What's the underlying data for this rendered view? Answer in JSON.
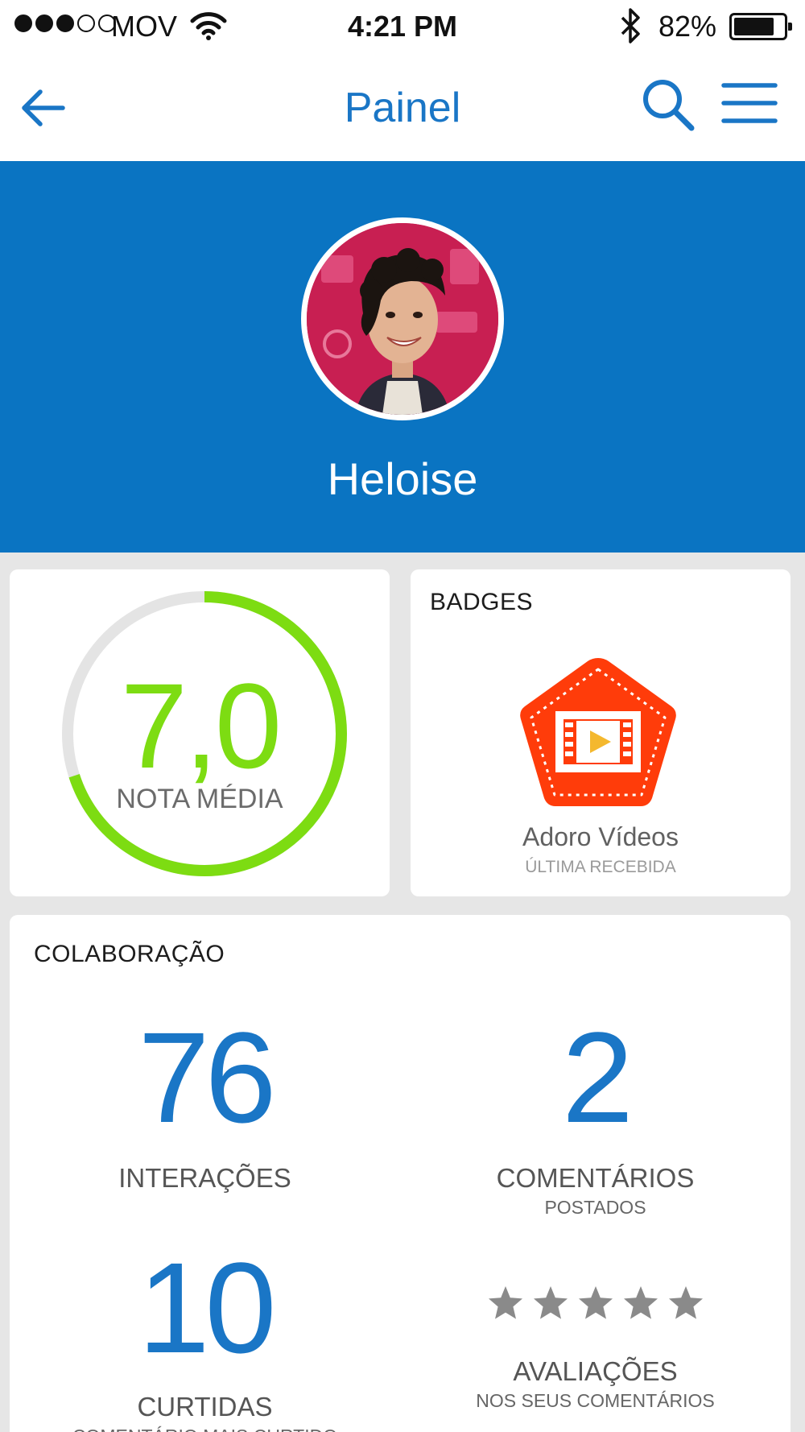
{
  "status": {
    "signal": [
      true,
      true,
      true,
      false,
      false
    ],
    "carrier": "MOV",
    "time": "4:21 PM",
    "battery_pct": "82%",
    "battery_level": 0.82
  },
  "nav": {
    "title": "Painel"
  },
  "profile": {
    "name": "Heloise"
  },
  "score": {
    "value": "7,0",
    "label": "NOTA MÉDIA",
    "fraction": 0.7
  },
  "badges": {
    "title": "BADGES",
    "latest_name": "Adoro Vídeos",
    "latest_caption": "ÚLTIMA RECEBIDA"
  },
  "collab": {
    "title": "COLABORAÇÃO",
    "interactions": {
      "value": "76",
      "label": "INTERAÇÕES"
    },
    "comments": {
      "value": "2",
      "label": "COMENTÁRIOS",
      "sub": "POSTADOS"
    },
    "likes": {
      "value": "10",
      "label": "CURTIDAS",
      "sub": "COMENTÁRIO MAIS CURTIDO"
    },
    "ratings": {
      "stars": 5,
      "label": "AVALIAÇÕES",
      "sub": "NOS SEUS COMENTÁRIOS"
    }
  },
  "colors": {
    "brand_blue": "#0a74c2",
    "nav_blue": "#1a76c6",
    "score_green": "#7ddc12",
    "badge_orange": "#ff3c0a",
    "star_gray": "#8a8a8a"
  }
}
